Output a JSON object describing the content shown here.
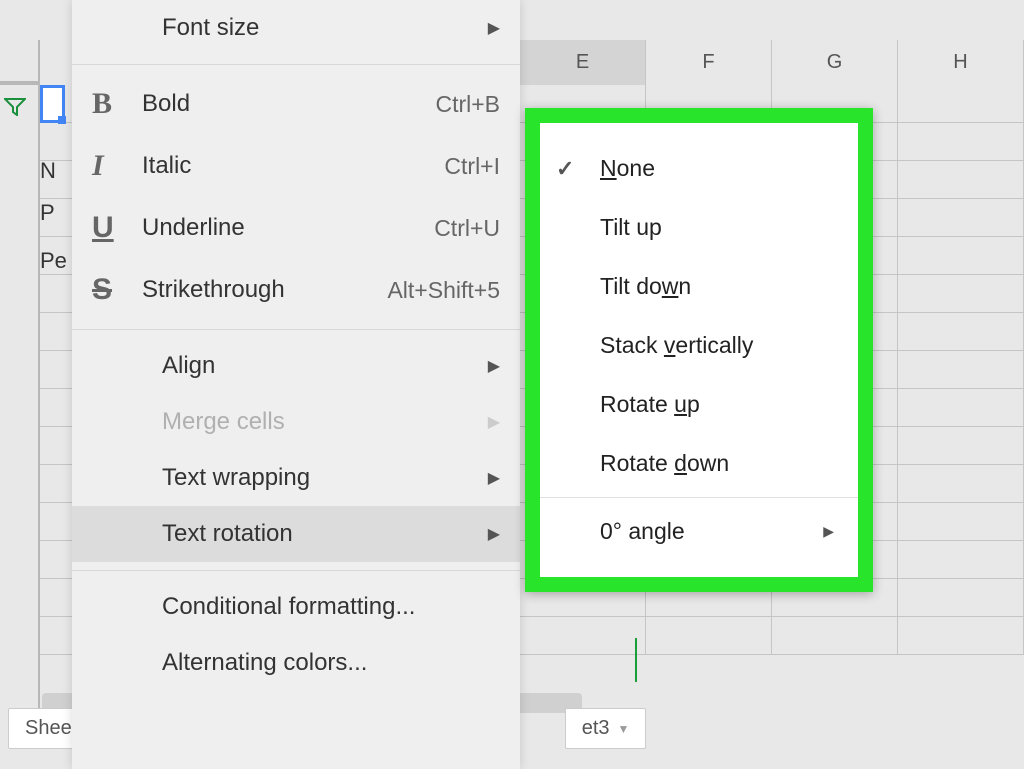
{
  "columns": [
    "E",
    "F",
    "G",
    "H"
  ],
  "partial_text": {
    "r1": "N",
    "r2": "P",
    "r3": "Pe"
  },
  "sheet_tabs": {
    "left": "Shee",
    "right_partial": "et3"
  },
  "format_menu": {
    "font_size": "Font size",
    "bold": {
      "label": "Bold",
      "shortcut": "Ctrl+B"
    },
    "italic": {
      "label": "Italic",
      "shortcut": "Ctrl+I"
    },
    "underline": {
      "label": "Underline",
      "shortcut": "Ctrl+U"
    },
    "strikethrough": {
      "label": "Strikethrough",
      "shortcut": "Alt+Shift+5"
    },
    "align": "Align",
    "merge_cells": "Merge cells",
    "text_wrapping": "Text wrapping",
    "text_rotation": "Text rotation",
    "conditional_formatting": "Conditional formatting...",
    "alternating_colors": "Alternating colors..."
  },
  "rotation_submenu": {
    "none": "None",
    "tilt_up": "Tilt up",
    "tilt_down": "Tilt down",
    "stack_vertically": "Stack vertically",
    "rotate_up": "Rotate up",
    "rotate_down": "Rotate down",
    "angle": "0° angle"
  },
  "colors": {
    "highlight": "#28e52c",
    "menu_bg": "#efefef"
  }
}
